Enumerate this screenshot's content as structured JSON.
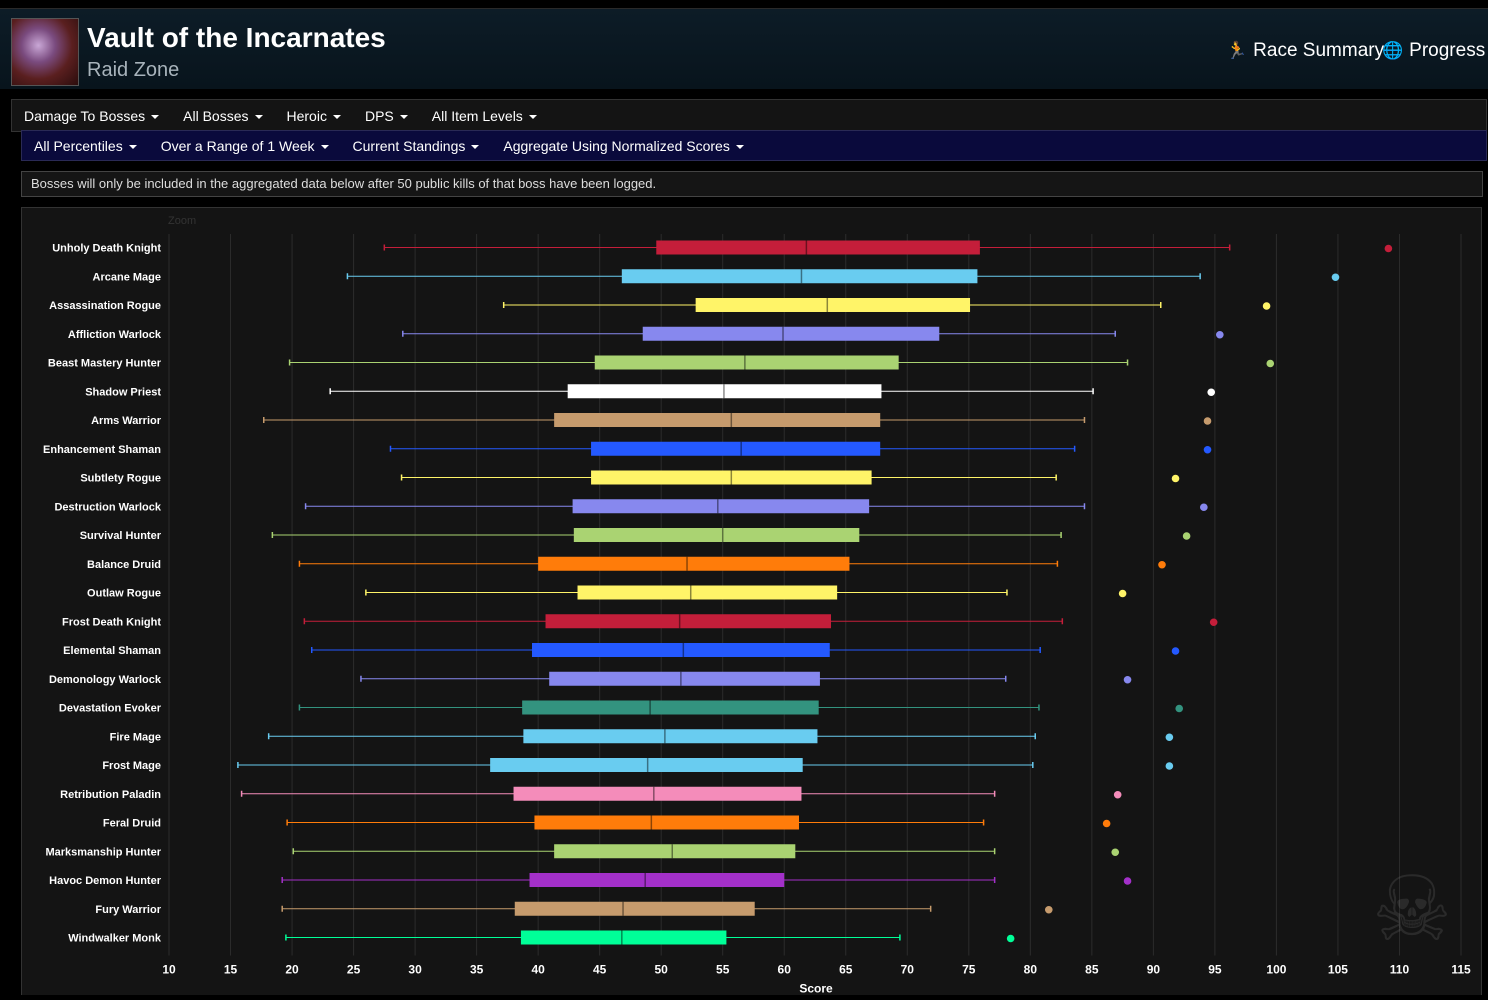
{
  "header": {
    "title": "Vault of the Incarnates",
    "subtitle": "Raid Zone",
    "race_summary": "Race Summary",
    "progress": "Progress"
  },
  "filters_row1": [
    "Damage To Bosses",
    "All Bosses",
    "Heroic",
    "DPS",
    "All Item Levels"
  ],
  "filters_row2": [
    "All Percentiles",
    "Over a Range of 1 Week",
    "Current Standings",
    "Aggregate Using Normalized Scores"
  ],
  "notice": "Bosses will only be included in the aggregated data below after 50 public kills of that boss have been logged.",
  "zoom_label": "Zoom",
  "chart_data": {
    "type": "box",
    "xlabel": "Score",
    "xlim": [
      10,
      115
    ],
    "xticks": [
      10,
      15,
      20,
      25,
      30,
      35,
      40,
      45,
      50,
      55,
      60,
      65,
      70,
      75,
      80,
      85,
      90,
      95,
      100,
      105,
      110,
      115
    ],
    "series": [
      {
        "name": "Unholy Death Knight",
        "color": "#C41E3A",
        "min": 27.5,
        "q1": 49.6,
        "median": 61.8,
        "q3": 75.9,
        "max": 96.2,
        "outlier": 109.1
      },
      {
        "name": "Arcane Mage",
        "color": "#69CCF0",
        "min": 24.5,
        "q1": 46.8,
        "median": 61.4,
        "q3": 75.7,
        "max": 93.8,
        "outlier": 104.8
      },
      {
        "name": "Assassination Rogue",
        "color": "#FFF468",
        "min": 37.2,
        "q1": 52.8,
        "median": 63.5,
        "q3": 75.1,
        "max": 90.6,
        "outlier": 99.2
      },
      {
        "name": "Affliction Warlock",
        "color": "#8788EE",
        "min": 29.0,
        "q1": 48.5,
        "median": 59.9,
        "q3": 72.6,
        "max": 86.9,
        "outlier": 95.4
      },
      {
        "name": "Beast Mastery Hunter",
        "color": "#AAD372",
        "min": 19.8,
        "q1": 44.6,
        "median": 56.8,
        "q3": 69.3,
        "max": 87.9,
        "outlier": 99.5
      },
      {
        "name": "Shadow Priest",
        "color": "#FFFFFF",
        "min": 23.1,
        "q1": 42.4,
        "median": 55.1,
        "q3": 67.9,
        "max": 85.1,
        "outlier": 94.7
      },
      {
        "name": "Arms Warrior",
        "color": "#C69B6D",
        "min": 17.7,
        "q1": 41.3,
        "median": 55.7,
        "q3": 67.8,
        "max": 84.4,
        "outlier": 94.4
      },
      {
        "name": "Enhancement Shaman",
        "color": "#2459FF",
        "min": 28.0,
        "q1": 44.3,
        "median": 56.5,
        "q3": 67.8,
        "max": 83.6,
        "outlier": 94.4
      },
      {
        "name": "Subtlety Rogue",
        "color": "#FFF468",
        "min": 28.9,
        "q1": 44.3,
        "median": 55.7,
        "q3": 67.1,
        "max": 82.1,
        "outlier": 91.8
      },
      {
        "name": "Destruction Warlock",
        "color": "#8788EE",
        "min": 21.1,
        "q1": 42.8,
        "median": 54.6,
        "q3": 66.9,
        "max": 84.4,
        "outlier": 94.1
      },
      {
        "name": "Survival Hunter",
        "color": "#AAD372",
        "min": 18.4,
        "q1": 42.9,
        "median": 55.0,
        "q3": 66.1,
        "max": 82.5,
        "outlier": 92.7
      },
      {
        "name": "Balance Druid",
        "color": "#FF7C0A",
        "min": 20.6,
        "q1": 40.0,
        "median": 52.1,
        "q3": 65.3,
        "max": 82.2,
        "outlier": 90.7
      },
      {
        "name": "Outlaw Rogue",
        "color": "#FFF468",
        "min": 26.0,
        "q1": 43.2,
        "median": 52.4,
        "q3": 64.3,
        "max": 78.1,
        "outlier": 87.5
      },
      {
        "name": "Frost Death Knight",
        "color": "#C41E3A",
        "min": 21.0,
        "q1": 40.6,
        "median": 51.5,
        "q3": 63.8,
        "max": 82.6,
        "outlier": 94.9
      },
      {
        "name": "Elemental Shaman",
        "color": "#2459FF",
        "min": 21.6,
        "q1": 39.5,
        "median": 51.8,
        "q3": 63.7,
        "max": 80.8,
        "outlier": 91.8
      },
      {
        "name": "Demonology Warlock",
        "color": "#8788EE",
        "min": 25.6,
        "q1": 40.9,
        "median": 51.6,
        "q3": 62.9,
        "max": 78.0,
        "outlier": 87.9
      },
      {
        "name": "Devastation Evoker",
        "color": "#33937F",
        "min": 20.6,
        "q1": 38.7,
        "median": 49.1,
        "q3": 62.8,
        "max": 80.7,
        "outlier": 92.1
      },
      {
        "name": "Fire Mage",
        "color": "#69CCF0",
        "min": 18.1,
        "q1": 38.8,
        "median": 50.3,
        "q3": 62.7,
        "max": 80.4,
        "outlier": 91.3
      },
      {
        "name": "Frost Mage",
        "color": "#69CCF0",
        "min": 15.6,
        "q1": 36.1,
        "median": 48.9,
        "q3": 61.5,
        "max": 80.2,
        "outlier": 91.3
      },
      {
        "name": "Retribution Paladin",
        "color": "#F48CBA",
        "min": 15.9,
        "q1": 38.0,
        "median": 49.4,
        "q3": 61.4,
        "max": 77.1,
        "outlier": 87.1
      },
      {
        "name": "Feral Druid",
        "color": "#FF7C0A",
        "min": 19.6,
        "q1": 39.7,
        "median": 49.2,
        "q3": 61.2,
        "max": 76.2,
        "outlier": 86.2
      },
      {
        "name": "Marksmanship Hunter",
        "color": "#AAD372",
        "min": 20.1,
        "q1": 41.3,
        "median": 50.9,
        "q3": 60.9,
        "max": 77.1,
        "outlier": 86.9
      },
      {
        "name": "Havoc Demon Hunter",
        "color": "#A330C9",
        "min": 19.2,
        "q1": 39.3,
        "median": 48.7,
        "q3": 60.0,
        "max": 77.1,
        "outlier": 87.9
      },
      {
        "name": "Fury Warrior",
        "color": "#C69B6D",
        "min": 19.2,
        "q1": 38.1,
        "median": 46.9,
        "q3": 57.6,
        "max": 71.9,
        "outlier": 81.5
      },
      {
        "name": "Windwalker Monk",
        "color": "#00FF98",
        "min": 19.5,
        "q1": 38.6,
        "median": 46.8,
        "q3": 55.3,
        "max": 69.4,
        "outlier": 78.4
      }
    ]
  }
}
